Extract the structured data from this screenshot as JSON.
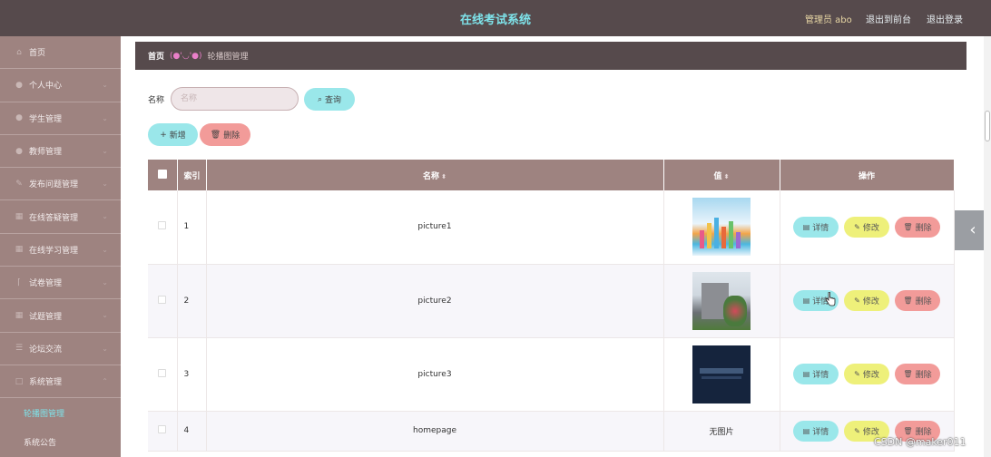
{
  "header": {
    "title": "在线考试系统",
    "admin": "管理员 abo",
    "link_front": "退出到前台",
    "link_logout": "退出登录"
  },
  "sidebar": {
    "items": [
      {
        "label": "首页",
        "icon": "home-icon"
      },
      {
        "label": "个人中心",
        "icon": "user-icon"
      },
      {
        "label": "学生管理",
        "icon": "user-icon"
      },
      {
        "label": "教师管理",
        "icon": "user-icon"
      },
      {
        "label": "发布问题管理",
        "icon": "edit-icon"
      },
      {
        "label": "在线答疑管理",
        "icon": "grid-icon"
      },
      {
        "label": "在线学习管理",
        "icon": "grid-icon"
      },
      {
        "label": "试卷管理",
        "icon": "bracket-icon"
      },
      {
        "label": "试题管理",
        "icon": "grid-icon"
      },
      {
        "label": "论坛交流",
        "icon": "list-icon"
      },
      {
        "label": "系统管理",
        "icon": "square-icon"
      }
    ],
    "subitems": [
      {
        "label": "轮播图管理",
        "active": true
      },
      {
        "label": "系统公告",
        "active": false
      }
    ]
  },
  "breadcrumb": {
    "home": "首页",
    "face": "(●'◡'●)",
    "current": "轮播图管理"
  },
  "search": {
    "label": "名称",
    "placeholder": "名称",
    "query_label": "查询"
  },
  "actions": {
    "add_label": "新增",
    "delete_label": "删除"
  },
  "table": {
    "columns": {
      "index": "索引",
      "name": "名称",
      "value": "值",
      "ops": "操作"
    },
    "rows": [
      {
        "index": "1",
        "name": "picture1",
        "value": "",
        "image": "thumb1"
      },
      {
        "index": "2",
        "name": "picture2",
        "value": "",
        "image": "thumb2"
      },
      {
        "index": "3",
        "name": "picture3",
        "value": "",
        "image": "thumb3"
      },
      {
        "index": "4",
        "name": "homepage",
        "value": "无图片",
        "image": ""
      }
    ],
    "op_labels": {
      "detail": "详情",
      "edit": "修改",
      "delete": "删除"
    }
  },
  "watermark": "CSDN @maker011",
  "colors": {
    "header_bg": "#564a4c",
    "title_color": "#7ee3ea",
    "sidebar_bg": "#9e8380",
    "btn_cyan": "#9ae7ea",
    "btn_red": "#f29b99",
    "btn_yellow": "#eef07a"
  }
}
